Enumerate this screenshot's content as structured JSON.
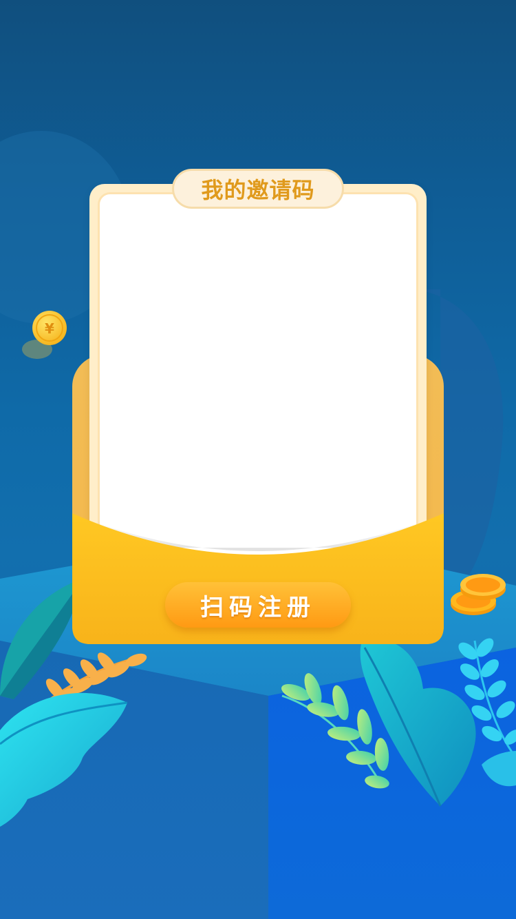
{
  "card": {
    "title": "我的邀请码",
    "qr_code_area": ""
  },
  "actions": {
    "scan_register_label": "扫码注册"
  },
  "colors": {
    "background_top": "#104f7e",
    "background_bottom": "#0f65a7",
    "envelope": "#f4b84a",
    "button": "#ff9a13",
    "title_text": "#e09a1c"
  },
  "decorations": {
    "coin_icon": "yuan-coin-icon",
    "coin_stack_icon": "coin-stack-icon",
    "left_plants": "leaf-plants-left",
    "right_plants": "leaf-plants-right"
  }
}
